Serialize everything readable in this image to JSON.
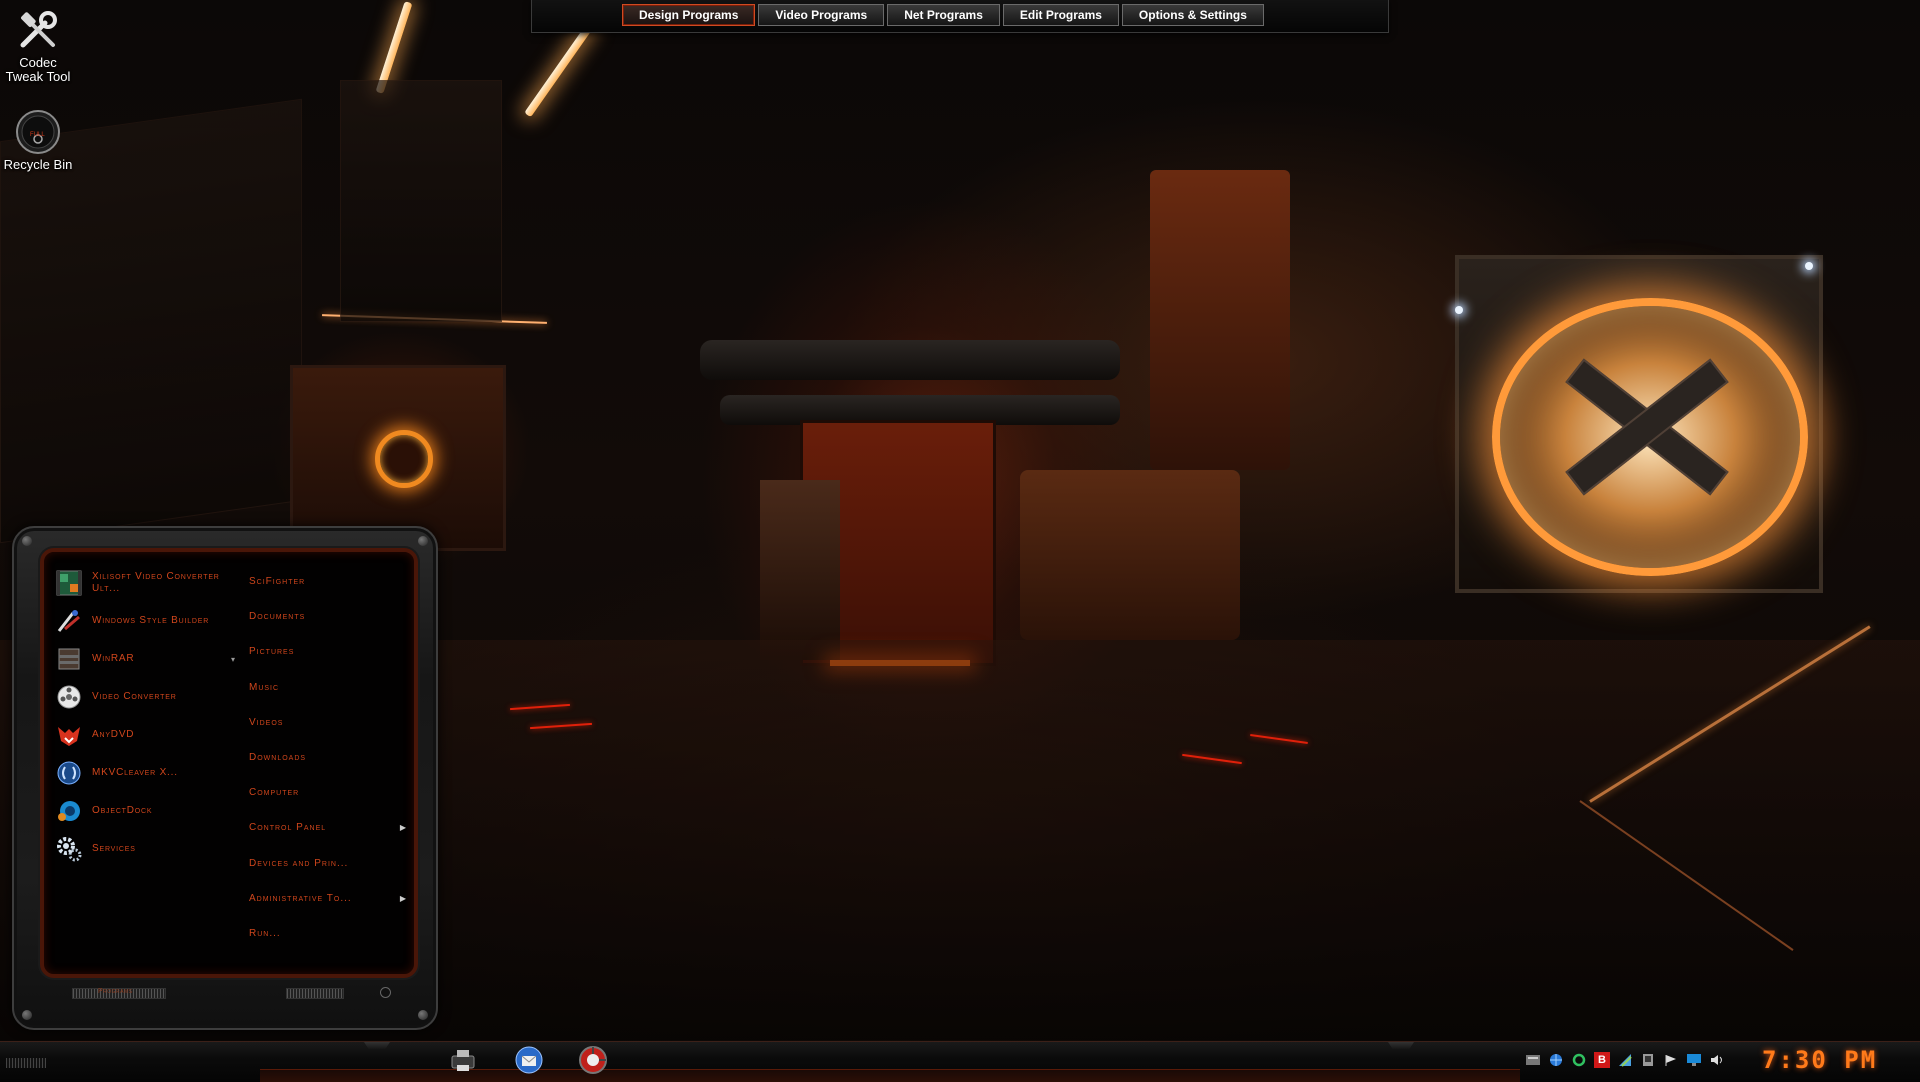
{
  "desktop": {
    "icons": [
      {
        "label": "Codec Tweak Tool",
        "icon": "tools-icon"
      },
      {
        "label": "Recycle Bin",
        "icon": "recycle-bin-icon",
        "badge": "FULL"
      }
    ]
  },
  "topbar": {
    "tabs": [
      {
        "label": "Design Programs",
        "active": true
      },
      {
        "label": "Video Programs"
      },
      {
        "label": "Net Programs"
      },
      {
        "label": "Edit Programs"
      },
      {
        "label": "Options & Settings"
      }
    ]
  },
  "start_menu": {
    "programs": [
      {
        "label": "Xilisoft Video Converter Ult...",
        "icon": "film-converter-icon"
      },
      {
        "label": "Windows Style Builder",
        "icon": "style-builder-icon"
      },
      {
        "label": "WinRAR",
        "icon": "winrar-icon"
      },
      {
        "label": "Video Converter",
        "icon": "video-reel-icon"
      },
      {
        "label": "AnyDVD",
        "icon": "fox-icon"
      },
      {
        "label": "MKVCleaver X...",
        "icon": "mkv-icon"
      },
      {
        "label": "ObjectDock",
        "icon": "objectdock-icon"
      },
      {
        "label": "Services",
        "icon": "gears-icon"
      }
    ],
    "places": [
      {
        "label": "SciFighter"
      },
      {
        "label": "Documents"
      },
      {
        "label": "Pictures"
      },
      {
        "label": "Music"
      },
      {
        "label": "Videos"
      },
      {
        "label": "Downloads"
      },
      {
        "label": "Computer"
      },
      {
        "label": "Control Panel",
        "submenu": true
      },
      {
        "label": "Devices and Prin..."
      },
      {
        "label": "Administrative To...",
        "submenu": true
      },
      {
        "label": "Run..."
      }
    ],
    "footer_label": "Programs"
  },
  "taskbar": {
    "apps": [
      {
        "icon": "printer-icon"
      },
      {
        "icon": "thunderbird-icon"
      },
      {
        "icon": "browser-icon"
      }
    ],
    "tray": [
      "keyboard-icon",
      "globe-icon",
      "sync-icon",
      "bitdefender-icon",
      "network-icon",
      "device-icon",
      "flag-icon",
      "monitor-icon",
      "volume-icon"
    ],
    "tray_badge": "B",
    "clock": "7:30 PM"
  },
  "colors": {
    "accent": "#d0461c",
    "clock": "#ff7a1a",
    "tab_active_border": "#cf4b22"
  }
}
